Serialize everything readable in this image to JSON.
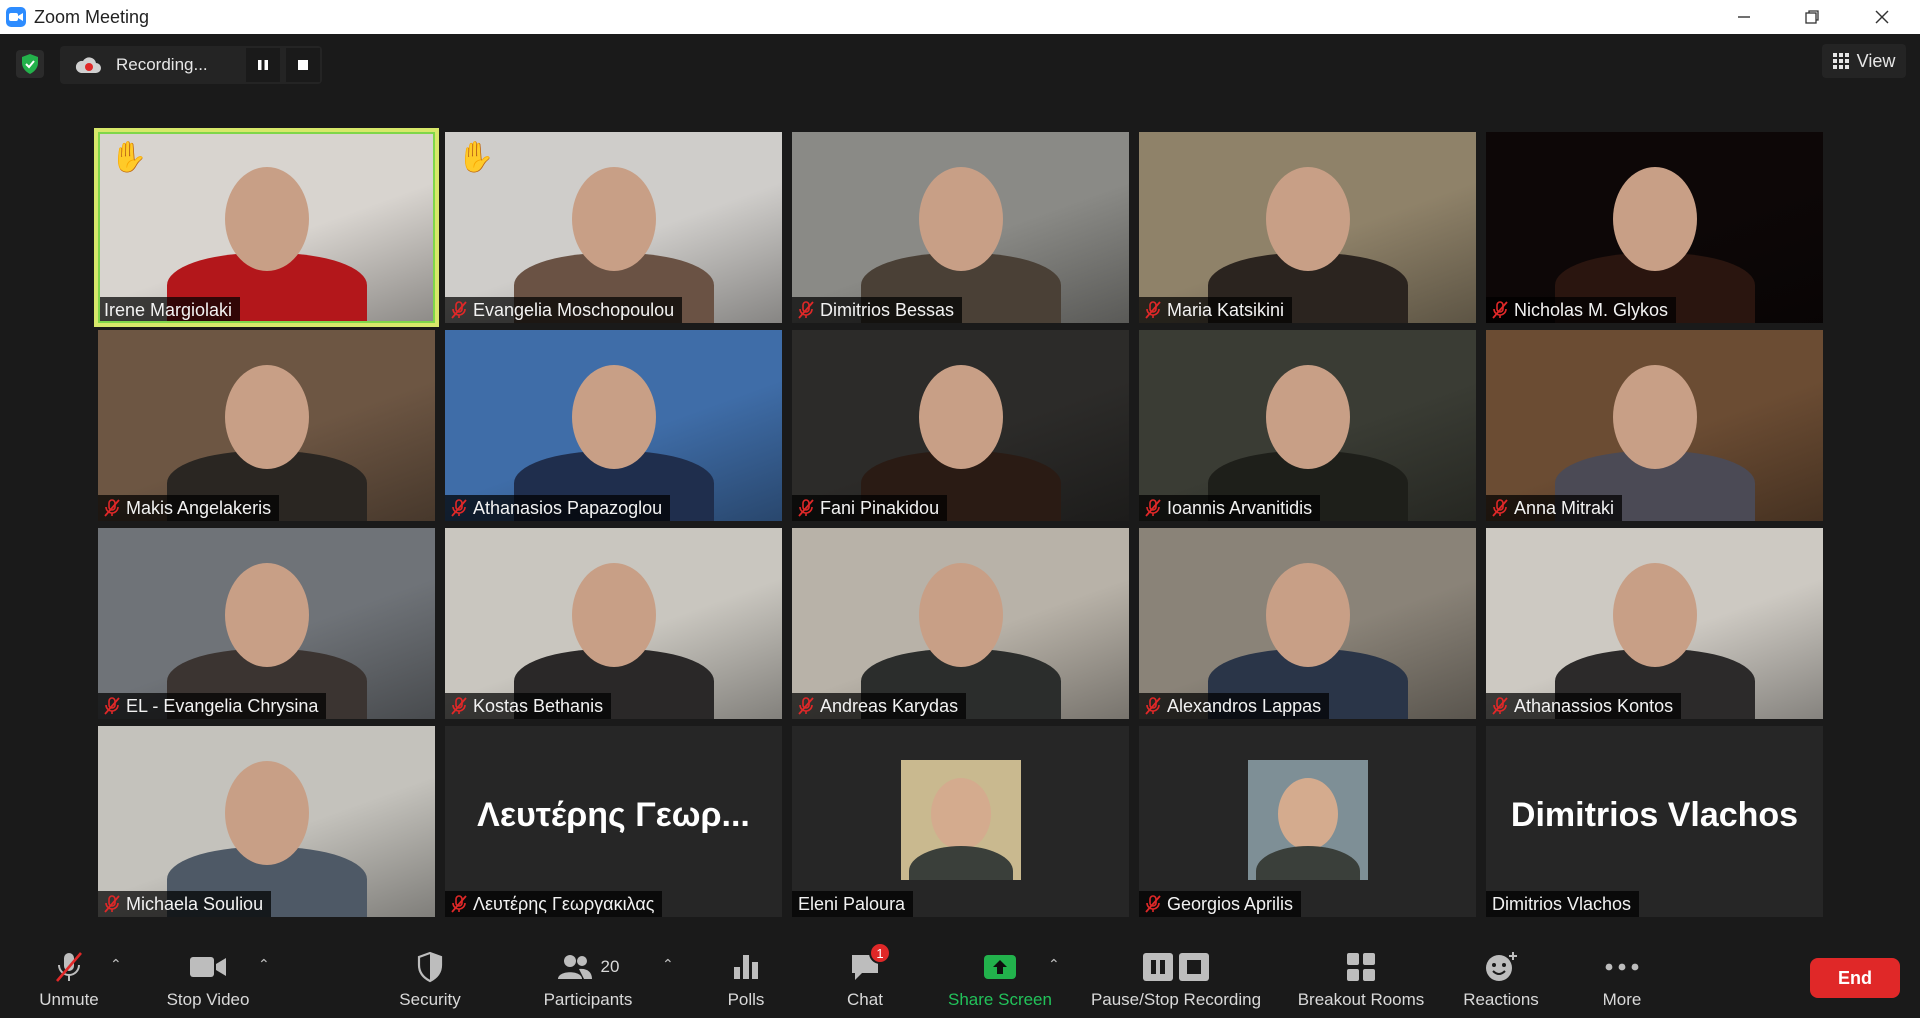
{
  "window": {
    "title": "Zoom Meeting",
    "minimize_icon": "minimize-icon",
    "restore_icon": "restore-icon",
    "close_icon": "close-icon"
  },
  "recording": {
    "status": "Recording...",
    "pause_icon": "pause-icon",
    "stop_icon": "stop-icon"
  },
  "view_button": "View",
  "colors": {
    "active_speaker_border": "#d7e86a",
    "end_button": "#e02828",
    "share_green": "#22b24c",
    "muted_red": "#e02828"
  },
  "participants": [
    {
      "name": "Irene Margiolaki",
      "muted": false,
      "hand_raised": true,
      "active": true,
      "display": "video",
      "bg": "#d8d4cf",
      "accent": "#b3171b"
    },
    {
      "name": "Evangelia Moschopoulou",
      "muted": true,
      "hand_raised": true,
      "active": false,
      "display": "video",
      "bg": "#cfcdca",
      "accent": "#6a5244"
    },
    {
      "name": "Dimitrios Bessas",
      "muted": true,
      "hand_raised": false,
      "active": false,
      "display": "video",
      "bg": "#8a8a86",
      "accent": "#4a4036"
    },
    {
      "name": "Maria Katsikini",
      "muted": true,
      "hand_raised": false,
      "active": false,
      "display": "video",
      "bg": "#8f8269",
      "accent": "#2b241f"
    },
    {
      "name": "Nicholas M. Glykos",
      "muted": true,
      "hand_raised": false,
      "active": false,
      "display": "video",
      "bg": "#0d0707",
      "accent": "#2a150f"
    },
    {
      "name": "Makis Angelakeris",
      "muted": true,
      "hand_raised": false,
      "active": false,
      "display": "video",
      "bg": "#6d5643",
      "accent": "#2a2622"
    },
    {
      "name": "Athanasios Papazoglou",
      "muted": true,
      "hand_raised": false,
      "active": false,
      "display": "video",
      "bg": "#3f6da8",
      "accent": "#1f2e4d"
    },
    {
      "name": "Fani Pinakidou",
      "muted": true,
      "hand_raised": false,
      "active": false,
      "display": "video",
      "bg": "#2c2b29",
      "accent": "#2a1b14"
    },
    {
      "name": "Ioannis Arvanitidis",
      "muted": true,
      "hand_raised": false,
      "active": false,
      "display": "video",
      "bg": "#3a3c34",
      "accent": "#1e1f1a"
    },
    {
      "name": "Anna Mitraki",
      "muted": true,
      "hand_raised": false,
      "active": false,
      "display": "video",
      "bg": "#6b4c33",
      "accent": "#4b4a55"
    },
    {
      "name": "EL - Evangelia Chrysina",
      "muted": true,
      "hand_raised": false,
      "active": false,
      "display": "video",
      "bg": "#6f7378",
      "accent": "#3b3431"
    },
    {
      "name": "Kostas Bethanis",
      "muted": true,
      "hand_raised": false,
      "active": false,
      "display": "video",
      "bg": "#c9c6bf",
      "accent": "#2a2828"
    },
    {
      "name": "Andreas Karydas",
      "muted": true,
      "hand_raised": false,
      "active": false,
      "display": "video",
      "bg": "#b8b2a8",
      "accent": "#2b2d2c"
    },
    {
      "name": "Alexandros Lappas",
      "muted": true,
      "hand_raised": false,
      "active": false,
      "display": "video",
      "bg": "#8a8378",
      "accent": "#2a3548"
    },
    {
      "name": "Athanassios Kontos",
      "muted": true,
      "hand_raised": false,
      "active": false,
      "display": "video",
      "bg": "#cdc9c2",
      "accent": "#2c2a2a"
    },
    {
      "name": "Michaela Souliou",
      "muted": true,
      "hand_raised": false,
      "active": false,
      "display": "video",
      "bg": "#c4c2bc",
      "accent": "#4e5966"
    },
    {
      "name": "Λευτέρης Γεωργακιλας",
      "muted": true,
      "hand_raised": false,
      "active": false,
      "display": "text",
      "big_text": "Λευτέρης Γεωρ...",
      "bg": "#262626",
      "accent": "#262626"
    },
    {
      "name": "Eleni Paloura",
      "muted": false,
      "hand_raised": false,
      "active": false,
      "display": "avatar",
      "bg": "#262626",
      "accent": "#c9b98f"
    },
    {
      "name": "Georgios Aprilis",
      "muted": true,
      "hand_raised": false,
      "active": false,
      "display": "avatar",
      "bg": "#262626",
      "accent": "#7e8f96"
    },
    {
      "name": "Dimitrios Vlachos",
      "muted": false,
      "hand_raised": false,
      "active": false,
      "display": "text",
      "big_text": "Dimitrios Vlachos",
      "bg": "#262626",
      "accent": "#262626"
    }
  ],
  "toolbar": {
    "unmute": "Unmute",
    "stop_video": "Stop Video",
    "security": "Security",
    "participants": "Participants",
    "participants_count": "20",
    "polls": "Polls",
    "chat": "Chat",
    "chat_badge": "1",
    "share_screen": "Share Screen",
    "pause_stop_recording": "Pause/Stop Recording",
    "breakout_rooms": "Breakout Rooms",
    "reactions": "Reactions",
    "more": "More",
    "end": "End"
  }
}
